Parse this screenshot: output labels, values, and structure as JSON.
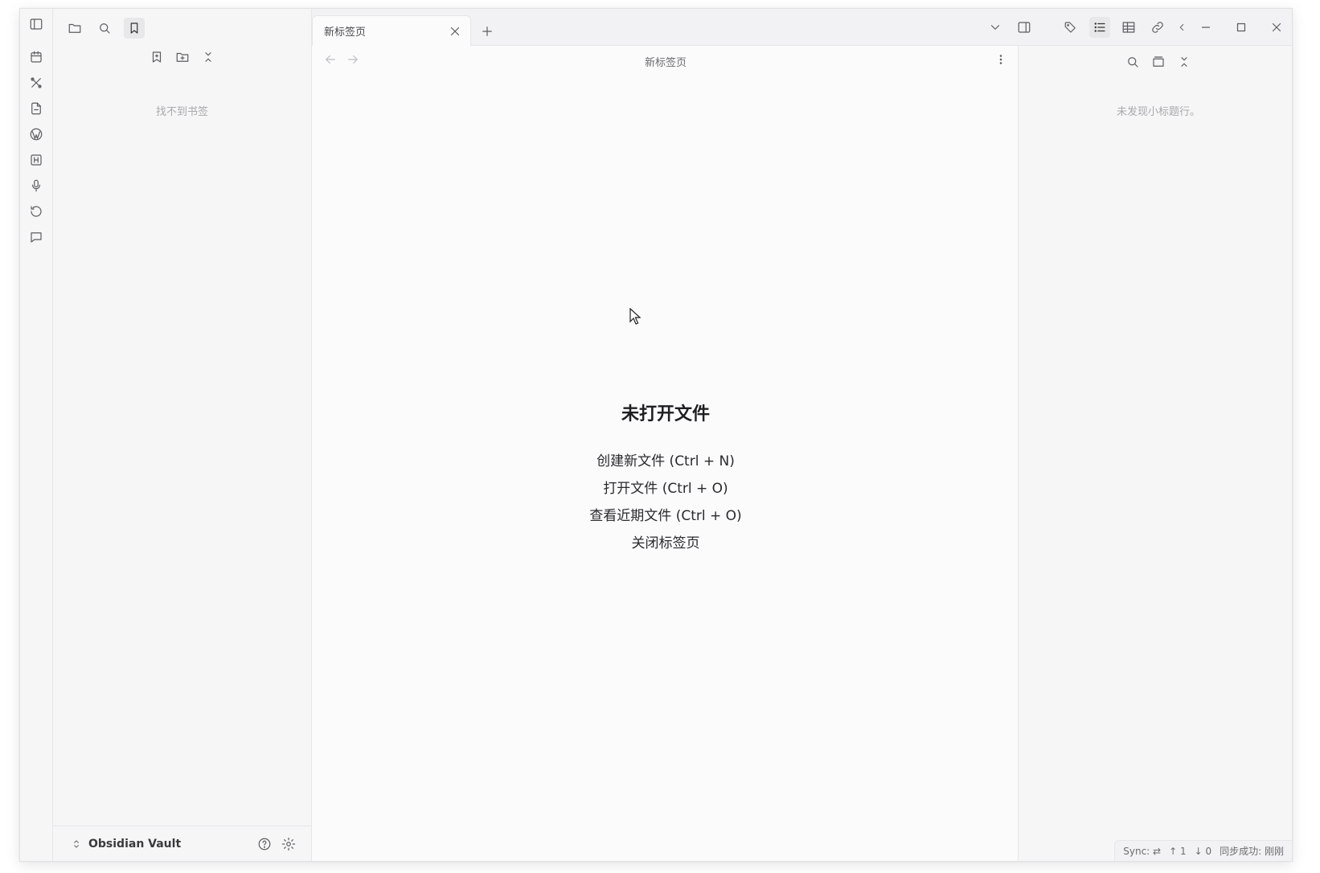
{
  "tab": {
    "title": "新标签页"
  },
  "main": {
    "view_title": "新标签页",
    "empty_title": "未打开文件",
    "actions": [
      "创建新文件 (Ctrl + N)",
      "打开文件 (Ctrl + O)",
      "查看近期文件 (Ctrl + O)",
      "关闭标签页"
    ]
  },
  "left_sidebar": {
    "empty_text": "找不到书签",
    "vault_name": "Obsidian Vault"
  },
  "right_sidebar": {
    "empty_text": "未发现小标题行。"
  },
  "status_bar": {
    "sync_label": "Sync:",
    "sync_glyph": "⇄",
    "up": "↑ 1",
    "down": "↓ 0",
    "status": "同步成功: 刚刚"
  },
  "icons": {
    "ribbon_top": "sidebar-toggle-icon",
    "ribbon": [
      "calendar-icon",
      "tools-icon",
      "file-export-icon",
      "wordpress-icon",
      "heading-icon",
      "microphone-icon",
      "history-icon",
      "comment-icon"
    ],
    "left_header": [
      "folder-icon",
      "search-icon",
      "bookmark-icon"
    ],
    "left_actions": [
      "add-bookmark-icon",
      "new-folder-icon",
      "collapse-icon"
    ],
    "right_actions": [
      "search-icon",
      "panel-icon",
      "collapse-icon"
    ],
    "top_right": [
      "chevron-down-icon",
      "right-sidebar-toggle-icon",
      "tags-icon",
      "outline-icon",
      "table-icon",
      "link-icon",
      "chevron-left-icon",
      "minimize-icon",
      "maximize-icon",
      "close-icon"
    ]
  },
  "colors": {
    "background": "#fbfbfc",
    "sidebar": "#f6f6f7",
    "muted_text": "#a9a9ad",
    "border": "#e6e6e8"
  }
}
